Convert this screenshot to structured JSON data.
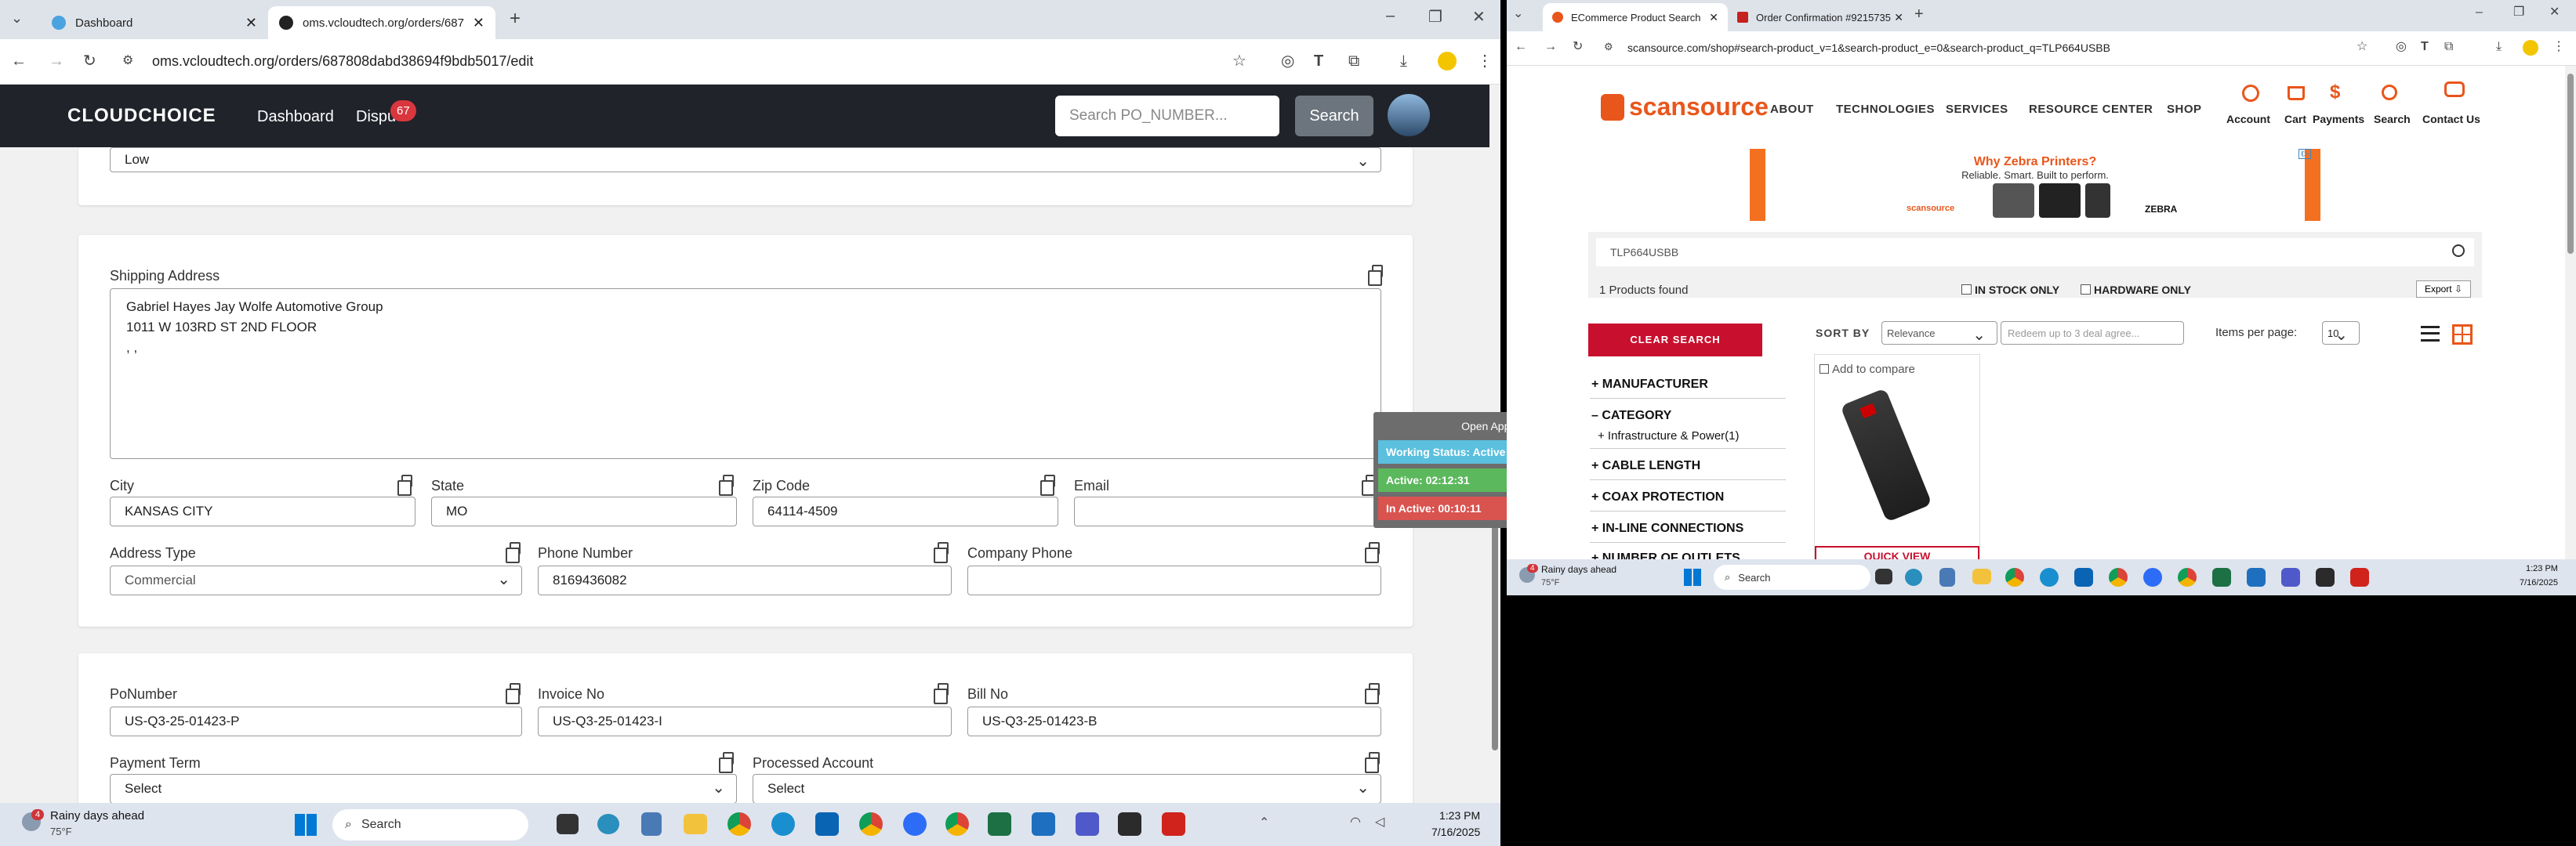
{
  "left_browser": {
    "tabs": [
      {
        "title": "Dashboard"
      },
      {
        "title": "oms.vcloudtech.org/orders/687"
      }
    ],
    "url": "oms.vcloudtech.org/orders/687808dabd38694f9bdb5017/edit"
  },
  "oms": {
    "logo": "CLOUDCHOICE",
    "nav": {
      "dashboard": "Dashboard",
      "disputes": "Dispu",
      "disputes_badge": "67"
    },
    "search": {
      "placeholder": "Search PO_NUMBER...",
      "button": "Search"
    },
    "priority_value": "Low",
    "shipping": {
      "label": "Shipping Address",
      "lines": [
        "Gabriel Hayes Jay Wolfe Automotive Group",
        "1011 W 103RD ST 2ND FLOOR",
        ", ,"
      ],
      "city_label": "City",
      "city": "KANSAS CITY",
      "state_label": "State",
      "state": "MO",
      "zip_label": "Zip Code",
      "zip": "64114-4509",
      "email_label": "Email",
      "email": "",
      "address_type_label": "Address Type",
      "address_type": "Commercial",
      "phone_label": "Phone Number",
      "phone": "8169436082",
      "company_phone_label": "Company Phone",
      "company_phone": ""
    },
    "billing": {
      "po_label": "PoNumber",
      "po": "US-Q3-25-01423-P",
      "invoice_label": "Invoice No",
      "invoice": "US-Q3-25-01423-I",
      "bill_label": "Bill No",
      "bill": "US-Q3-25-01423-B",
      "payment_term_label": "Payment Term",
      "payment_term": "Select",
      "processed_label": "Processed Account",
      "processed": "Select"
    }
  },
  "status_widget": {
    "open_app": "Open App ↗",
    "working": "Working Status: Active",
    "active": "Active: 02:12:31",
    "inactive": "In Active: 00:10:11",
    "colors": {
      "working": "#5bc0de",
      "active": "#5cb85c",
      "inactive": "#d9534f"
    }
  },
  "right_browser": {
    "tabs": [
      {
        "title": "ECommerce Product Search"
      },
      {
        "title": "Order Confirmation #9215735"
      }
    ],
    "url": "scansource.com/shop#search-product_v=1&search-product_e=0&search-product_q=TLP664USBB"
  },
  "scansource": {
    "logo": "scansource",
    "nav": [
      "ABOUT",
      "TECHNOLOGIES",
      "SERVICES",
      "RESOURCE CENTER",
      "SHOP"
    ],
    "icons": [
      "Account",
      "Cart",
      "Payments",
      "Search",
      "Contact Us"
    ],
    "banner": {
      "title": "Why Zebra Printers?",
      "sub": "Reliable. Smart. Built to perform.",
      "brand1": "scansource",
      "brand2": "ZEBRA"
    },
    "search_value": "TLP664USBB",
    "found": "1 Products found",
    "in_stock": "IN STOCK ONLY",
    "hardware": "HARDWARE ONLY",
    "export": "Export ⇩",
    "clear": "CLEAR SEARCH",
    "sort_by": "SORT BY",
    "sort_value": "Relevance",
    "deal_placeholder": "Redeem up to 3 deal agree...",
    "items_per_page": "Items per page:",
    "items_value": "10",
    "facets": [
      "+ MANUFACTURER",
      "– CATEGORY",
      "+ CABLE LENGTH",
      "+ COAX PROTECTION",
      "+ IN-LINE CONNECTIONS",
      "+ NUMBER OF OUTLETS"
    ],
    "sub_facet": "+ Infrastructure & Power(1)",
    "compare": "Add to compare",
    "quick_view": "QUICK VIEW"
  },
  "taskbar_left": {
    "weather_temp": "75°F",
    "weather_text": "Rainy days ahead",
    "weather_badge": "4",
    "search": "Search",
    "time": "1:23 PM",
    "date": "7/16/2025"
  },
  "taskbar_right": {
    "weather_temp": "75°F",
    "weather_text": "Rainy days ahead",
    "weather_badge": "4",
    "search": "Search",
    "time": "1:23 PM",
    "date": "7/16/2025"
  }
}
